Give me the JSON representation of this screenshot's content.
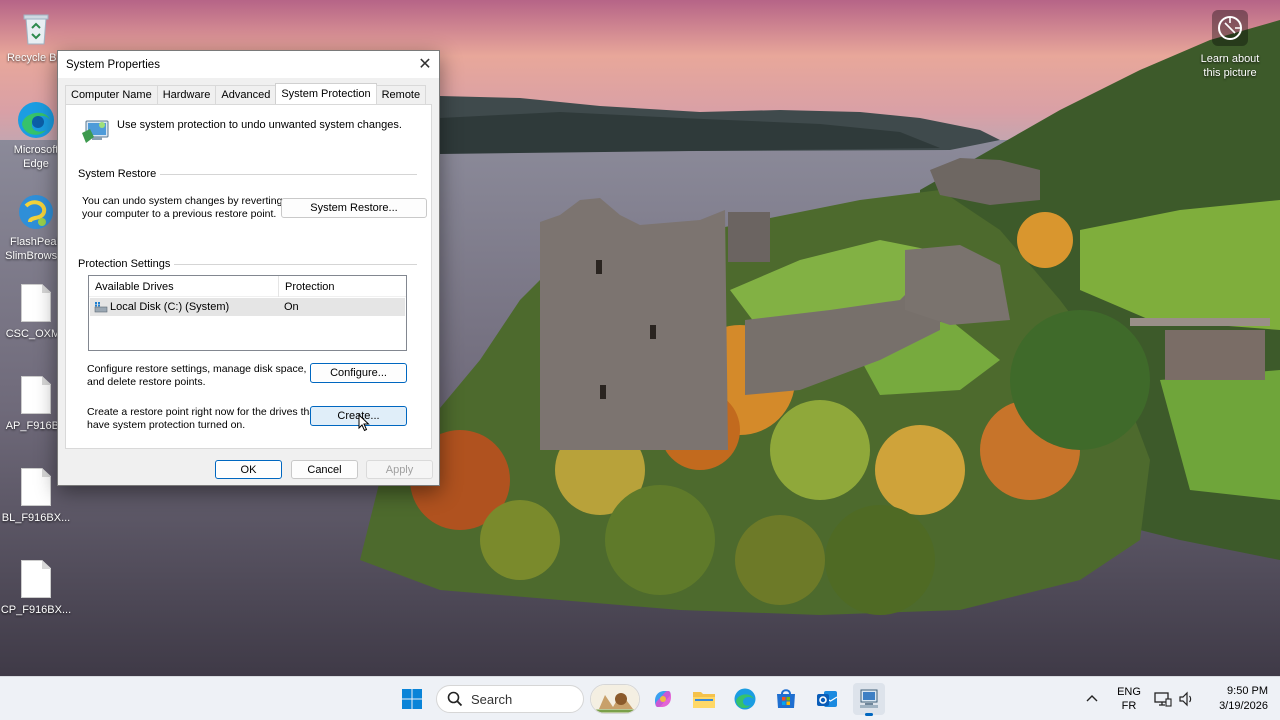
{
  "desktop": {
    "icons": [
      {
        "label": "Recycle Bin",
        "icon": "recycle-bin-icon"
      },
      {
        "label": "Microsoft Edge",
        "icon": "edge-icon"
      },
      {
        "label": "FlashPeak SlimBrowser",
        "icon": "slimbrowser-icon"
      },
      {
        "label": "CSC_OXM_",
        "icon": "file-icon"
      },
      {
        "label": "AP_F916BX",
        "icon": "file-icon"
      },
      {
        "label": "BL_F916BX...",
        "icon": "file-icon"
      },
      {
        "label": "CP_F916BX...",
        "icon": "file-icon"
      }
    ],
    "learn_line1": "Learn about",
    "learn_line2": "this picture"
  },
  "dialog": {
    "title": "System Properties",
    "close_label": "✕",
    "tabs": [
      "Computer Name",
      "Hardware",
      "Advanced",
      "System Protection",
      "Remote"
    ],
    "active_tab": "System Protection",
    "intro": "Use system protection to undo unwanted system changes.",
    "system_restore": {
      "group_title": "System Restore",
      "text_line1": "You can undo system changes by reverting",
      "text_line2": "your computer to a previous restore point.",
      "button": "System Restore..."
    },
    "protection": {
      "group_title": "Protection Settings",
      "col_drives": "Available Drives",
      "col_protection": "Protection",
      "rows": [
        {
          "drive": "Local Disk (C:) (System)",
          "protection": "On"
        }
      ],
      "configure_line1": "Configure restore settings, manage disk space,",
      "configure_line2": "and delete restore points.",
      "configure_button": "Configure...",
      "create_line1": "Create a restore point right now for the drives that",
      "create_line2": "have system protection turned on.",
      "create_button": "Create..."
    },
    "footer": {
      "ok": "OK",
      "cancel": "Cancel",
      "apply": "Apply"
    }
  },
  "taskbar": {
    "search_placeholder": "Search",
    "lang_line1": "ENG",
    "lang_line2": "FR",
    "time": "9:50 PM",
    "date": "3/19/2026"
  },
  "colors": {
    "accent": "#0067c0",
    "dialog_bg": "#f0f0f0",
    "taskbar_bg": "#eef1f6"
  }
}
